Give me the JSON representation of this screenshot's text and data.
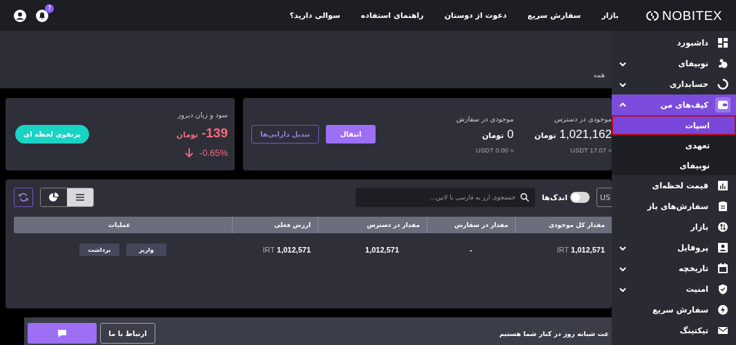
{
  "nav": {
    "logo": "NOBITEX",
    "links": [
      "بازار",
      "سفارش سریع",
      "دعوت از دوستان",
      "راهنمای استفاده",
      "سوالی دارید؟"
    ],
    "notification_count": "7"
  },
  "filter": {
    "label": "همه"
  },
  "balance_card": {
    "blocks": [
      {
        "label": "موجودی در دسترس",
        "amount": "1,021,162",
        "unit": "تومان",
        "usdt": "USDT 17.07 ≈"
      },
      {
        "label": "موجودی در سفارش",
        "amount": "0",
        "unit": "تومان",
        "usdt": "USDT 0.00 ≈"
      }
    ],
    "buttons": [
      {
        "label": "انتقال",
        "kind": "primary"
      },
      {
        "label": "تبدیل دارایی‌ها",
        "kind": "outline"
      }
    ]
  },
  "pnl_card": {
    "label": "سود و زیان دیروز",
    "amount": "-139",
    "unit": "تومان",
    "percent": "-0.65%",
    "button": "پرتفوی لحظه ای"
  },
  "toolbar": {
    "currency_button": "US",
    "small_toggle": {
      "label": "اندک‌ها",
      "on": false
    },
    "search": {
      "placeholder": "جستجوی ارز به فارسی یا لاتین..."
    },
    "views": [
      {
        "kind": "list",
        "selected": true
      },
      {
        "kind": "pie",
        "selected": false
      }
    ]
  },
  "table": {
    "columns": [
      "مقدار کل موجودی",
      "مقدار در سفارش",
      "مقدار در دسترس",
      "ارزش فعلی",
      "عملیات"
    ],
    "rows": [
      {
        "total": {
          "value": "1,012,571",
          "unit": "IRT"
        },
        "in_order": "-",
        "available": "1,012,571",
        "current_value": {
          "value": "1,012,571",
          "unit": "IRT"
        },
        "actions": [
          "واریز",
          "برداشت"
        ]
      }
    ]
  },
  "footer": {
    "text": "عت شبانه روز در کنار شما هستیم",
    "contact_button": "ارتباط با ما"
  },
  "sidebar": {
    "items": [
      {
        "label": "داشبورد"
      },
      {
        "label": "نوبیفای",
        "expanded": false
      },
      {
        "label": "حسابداری",
        "expanded": false
      },
      {
        "label": "کیف‌های من",
        "expanded": true,
        "children": [
          {
            "label": "اسپات",
            "selected": true
          },
          {
            "label": "تعهدی",
            "selected": false
          },
          {
            "label": "نوبیفای",
            "selected": false
          }
        ]
      },
      {
        "label": "قیمت لحظه‌ای"
      },
      {
        "label": "سفارش‌های باز"
      },
      {
        "label": "بازار"
      },
      {
        "label": "پروفایل",
        "expanded": false
      },
      {
        "label": "تاریخچه",
        "expanded": false
      },
      {
        "label": "امنیت",
        "expanded": false
      },
      {
        "label": "سفارش سریع"
      },
      {
        "label": "تیکتینگ"
      }
    ]
  }
}
